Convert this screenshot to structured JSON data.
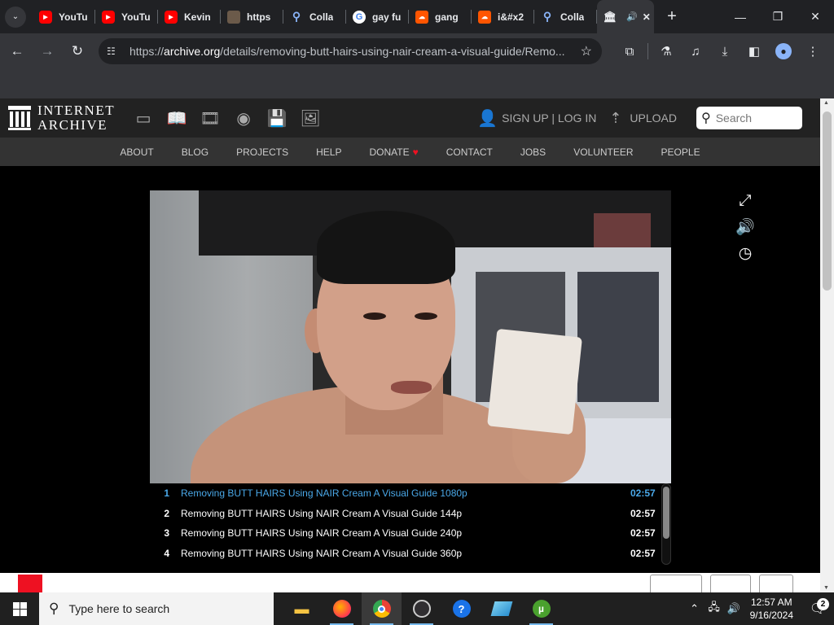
{
  "browser": {
    "tabs": [
      {
        "title": "YouTu",
        "favicon": "youtube-icon",
        "active": false
      },
      {
        "title": "YouTu",
        "favicon": "youtube-icon",
        "active": false
      },
      {
        "title": "Kevin",
        "favicon": "youtube-icon",
        "active": false
      },
      {
        "title": "https",
        "favicon": "image-icon",
        "active": false
      },
      {
        "title": "Colla",
        "favicon": "search-icon",
        "active": false
      },
      {
        "title": "gay fu",
        "favicon": "google-icon",
        "active": false
      },
      {
        "title": "gang",
        "favicon": "soundcloud-icon",
        "active": false
      },
      {
        "title": "i&#x2",
        "favicon": "soundcloud-icon",
        "active": false
      },
      {
        "title": "Colla",
        "favicon": "search-icon",
        "active": false
      }
    ],
    "active_tab": {
      "favicon": "archive-icon",
      "audio": true
    },
    "url_prefix": "https://",
    "url_domain": "archive.org",
    "url_path": "/details/removing-butt-hairs-using-nair-cream-a-visual-guide/Remo..."
  },
  "ia": {
    "logo_line1": "INTERNET",
    "logo_line2": "ARCHIVE",
    "signup_login": "SIGN UP | LOG IN",
    "upload": "UPLOAD",
    "search_placeholder": "Search",
    "nav": [
      "ABOUT",
      "BLOG",
      "PROJECTS",
      "HELP",
      "DONATE",
      "CONTACT",
      "JOBS",
      "VOLUNTEER",
      "PEOPLE"
    ]
  },
  "playlist": [
    {
      "num": "1",
      "title": "Removing BUTT HAIRS Using NAIR Cream A Visual Guide 1080p",
      "duration": "02:57",
      "active": true
    },
    {
      "num": "2",
      "title": "Removing BUTT HAIRS Using NAIR Cream A Visual Guide 144p",
      "duration": "02:57",
      "active": false
    },
    {
      "num": "3",
      "title": "Removing BUTT HAIRS Using NAIR Cream A Visual Guide 240p",
      "duration": "02:57",
      "active": false
    },
    {
      "num": "4",
      "title": "Removing BUTT HAIRS Using NAIR Cream A Visual Guide 360p",
      "duration": "02:57",
      "active": false
    }
  ],
  "taskbar": {
    "search_placeholder": "Type here to search",
    "time": "12:57 AM",
    "date": "9/16/2024",
    "notification_count": "2"
  },
  "colors": {
    "active_playlist": "#4aa8e8",
    "donate_heart": "#ee1122"
  }
}
